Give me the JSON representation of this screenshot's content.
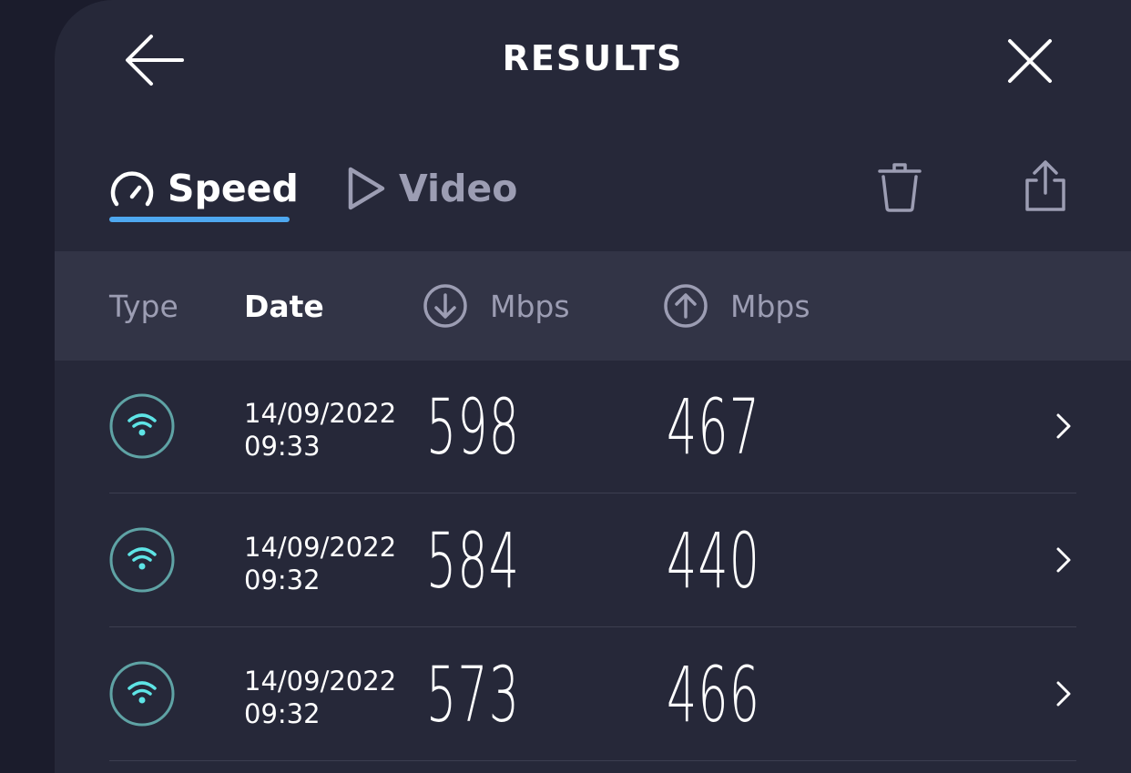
{
  "header": {
    "title": "RESULTS"
  },
  "tabs": [
    {
      "label": "Speed",
      "icon": "speedometer-icon",
      "active": true
    },
    {
      "label": "Video",
      "icon": "play-icon",
      "active": false
    }
  ],
  "table": {
    "columns": {
      "type": "Type",
      "date": "Date",
      "download": "Mbps",
      "upload": "Mbps"
    },
    "rows": [
      {
        "connection_icon": "wifi-icon",
        "date": "14/09/2022",
        "time": "09:33",
        "download": "598",
        "upload": "467"
      },
      {
        "connection_icon": "wifi-icon",
        "date": "14/09/2022",
        "time": "09:32",
        "download": "584",
        "upload": "440"
      },
      {
        "connection_icon": "wifi-icon",
        "date": "14/09/2022",
        "time": "09:32",
        "download": "573",
        "upload": "466"
      }
    ]
  },
  "colors": {
    "background": "#1b1c2c",
    "panel": "#262839",
    "header_row": "#323446",
    "accent_underline": "#4ea8f0",
    "wifi_accent": "#5ee4e6",
    "wifi_ring": "#5fa3a5",
    "muted_text": "#9c9db3"
  }
}
